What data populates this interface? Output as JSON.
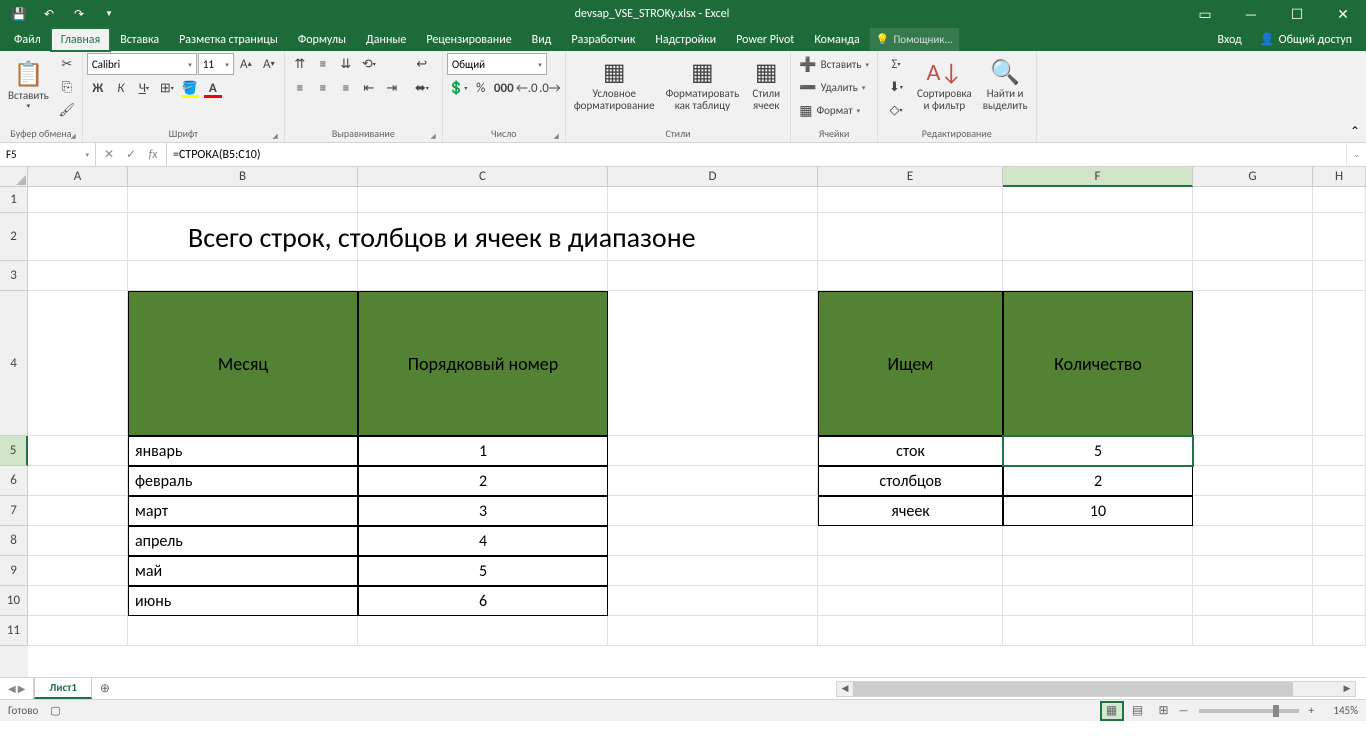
{
  "titlebar": {
    "filename": "devsap_VSE_STROKy.xlsx - Excel"
  },
  "tabs": {
    "file": "Файл",
    "home": "Главная",
    "insert": "Вставка",
    "pagelayout": "Разметка страницы",
    "formulas": "Формулы",
    "data": "Данные",
    "review": "Рецензирование",
    "view": "Вид",
    "developer": "Разработчик",
    "addins": "Надстройки",
    "powerpivot": "Power Pivot",
    "team": "Команда",
    "tellme": "Помощник...",
    "signin": "Вход",
    "share": "Общий доступ"
  },
  "ribbon": {
    "clipboard": {
      "paste": "Вставить",
      "label": "Буфер обмена"
    },
    "font": {
      "name": "Calibri",
      "size": "11",
      "label": "Шрифт"
    },
    "alignment": {
      "label": "Выравнивание"
    },
    "number": {
      "format": "Общий",
      "label": "Число"
    },
    "styles": {
      "cond": "Условное",
      "cond2": "форматирование",
      "fmt": "Форматировать",
      "fmt2": "как таблицу",
      "cell": "Стили",
      "cell2": "ячеек",
      "label": "Стили"
    },
    "cells": {
      "insert": "Вставить",
      "delete": "Удалить",
      "format": "Формат",
      "label": "Ячейки"
    },
    "editing": {
      "sort": "Сортировка",
      "sort2": "и фильтр",
      "find": "Найти и",
      "find2": "выделить",
      "label": "Редактирование"
    }
  },
  "namebox": "F5",
  "formula": "=СТРОКА(B5:C10)",
  "cols": [
    "A",
    "B",
    "C",
    "D",
    "E",
    "F",
    "G",
    "H"
  ],
  "rows": [
    "1",
    "2",
    "3",
    "4",
    "5",
    "6",
    "7",
    "8",
    "9",
    "10",
    "11"
  ],
  "sheet": {
    "title": "Всего строк, столбцов и ячеек в диапазоне",
    "left": {
      "h1": "Месяц",
      "h2": "Порядковый номер",
      "data": [
        [
          "январь",
          "1"
        ],
        [
          "февраль",
          "2"
        ],
        [
          "март",
          "3"
        ],
        [
          "апрель",
          "4"
        ],
        [
          "май",
          "5"
        ],
        [
          "июнь",
          "6"
        ]
      ]
    },
    "right": {
      "h1": "Ищем",
      "h2": "Количество",
      "data": [
        [
          "сток",
          "5"
        ],
        [
          "столбцов",
          "2"
        ],
        [
          "ячеек",
          "10"
        ]
      ]
    }
  },
  "sheettab": "Лист1",
  "status": {
    "ready": "Готово",
    "zoom": "145%"
  }
}
